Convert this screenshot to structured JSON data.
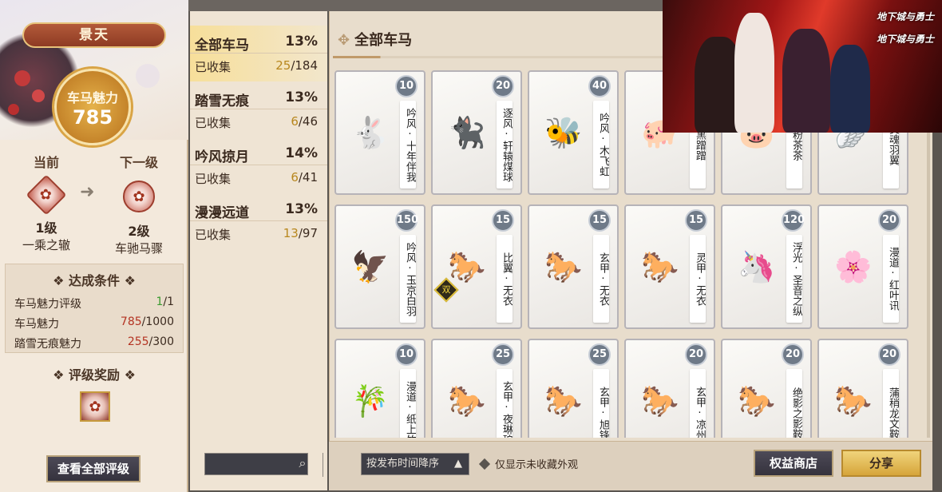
{
  "left": {
    "name": "景天",
    "charm_label": "车马魅力",
    "charm_value": "785",
    "current_label": "当前",
    "next_label": "下一级",
    "current_level": "1级",
    "current_name": "一乘之辙",
    "next_level": "2级",
    "next_name": "车驰马骤",
    "conditions_title": "达成条件",
    "conditions": [
      {
        "label": "车马魅力评级",
        "got": "1",
        "total": "/1",
        "color": "green"
      },
      {
        "label": "车马魅力",
        "got": "785",
        "total": "/1000",
        "color": "red"
      },
      {
        "label": "踏雪无痕魅力",
        "got": "255",
        "total": "/300",
        "color": "red"
      }
    ],
    "reward_title": "评级奖励",
    "view_all_button": "查看全部评级"
  },
  "categories": [
    {
      "name": "全部车马",
      "pct": "13%",
      "sub": "已收集",
      "got": "25",
      "total": "/184",
      "active": true
    },
    {
      "name": "踏雪无痕",
      "pct": "13%",
      "sub": "已收集",
      "got": "6",
      "total": "/46",
      "active": false
    },
    {
      "name": "吟风掠月",
      "pct": "14%",
      "sub": "已收集",
      "got": "6",
      "total": "/41",
      "active": false
    },
    {
      "name": "漫漫远道",
      "pct": "13%",
      "sub": "已收集",
      "got": "13",
      "total": "/97",
      "active": false
    }
  ],
  "main": {
    "title": "全部车马",
    "cards": [
      {
        "level": "10",
        "name": "吟风·十年伴我",
        "art": "🐇",
        "double": false
      },
      {
        "level": "20",
        "name": "逐风·轩辕煤球",
        "art": "🐈‍⬛",
        "double": false
      },
      {
        "level": "40",
        "name": "吟风·木飞虹",
        "art": "🐝",
        "double": false
      },
      {
        "level": "",
        "name": "黑蹭蹭",
        "art": "🐖",
        "double": false
      },
      {
        "level": "",
        "name": "粉茶茶",
        "art": "🐷",
        "double": false
      },
      {
        "level": "",
        "name": "灵魂羽翼",
        "art": "🪽",
        "double": false
      },
      {
        "level": "150",
        "name": "吟风·玉京白羽",
        "art": "🦅",
        "double": false
      },
      {
        "level": "15",
        "name": "比翼·无衣",
        "art": "🐎",
        "double": true,
        "double_label": "双"
      },
      {
        "level": "15",
        "name": "玄甲·无衣",
        "art": "🐎",
        "double": false
      },
      {
        "level": "15",
        "name": "灵甲·无衣",
        "art": "🐎",
        "double": false
      },
      {
        "level": "120",
        "name": "浮光·圣音之纵",
        "art": "🦄",
        "double": false
      },
      {
        "level": "20",
        "name": "漫道·红叶讯",
        "art": "🌸",
        "double": false
      },
      {
        "level": "10",
        "name": "漫道·纸上竹",
        "art": "🎋",
        "double": false
      },
      {
        "level": "25",
        "name": "玄甲·夜琳琅",
        "art": "🐎",
        "double": false
      },
      {
        "level": "25",
        "name": "玄甲·旭锋",
        "art": "🐎",
        "double": false
      },
      {
        "level": "20",
        "name": "玄甲·凉州",
        "art": "🐎",
        "double": false
      },
      {
        "level": "20",
        "name": "绝影之影鞍",
        "art": "🐎",
        "double": false
      },
      {
        "level": "20",
        "name": "蒲稍龙文鞍",
        "art": "🐎",
        "double": false
      }
    ]
  },
  "bottom": {
    "search_placeholder": "",
    "sort_label": "按发布时间降序",
    "only_uncollected": "仅显示未收藏外观",
    "shop_button": "权益商店",
    "share_button": "分享"
  },
  "ad": {
    "logo_text": "地下城与勇士"
  },
  "colors": {
    "accent_gold": "#b8871e",
    "ok_green": "#3a9a2e",
    "need_red": "#b43322"
  }
}
